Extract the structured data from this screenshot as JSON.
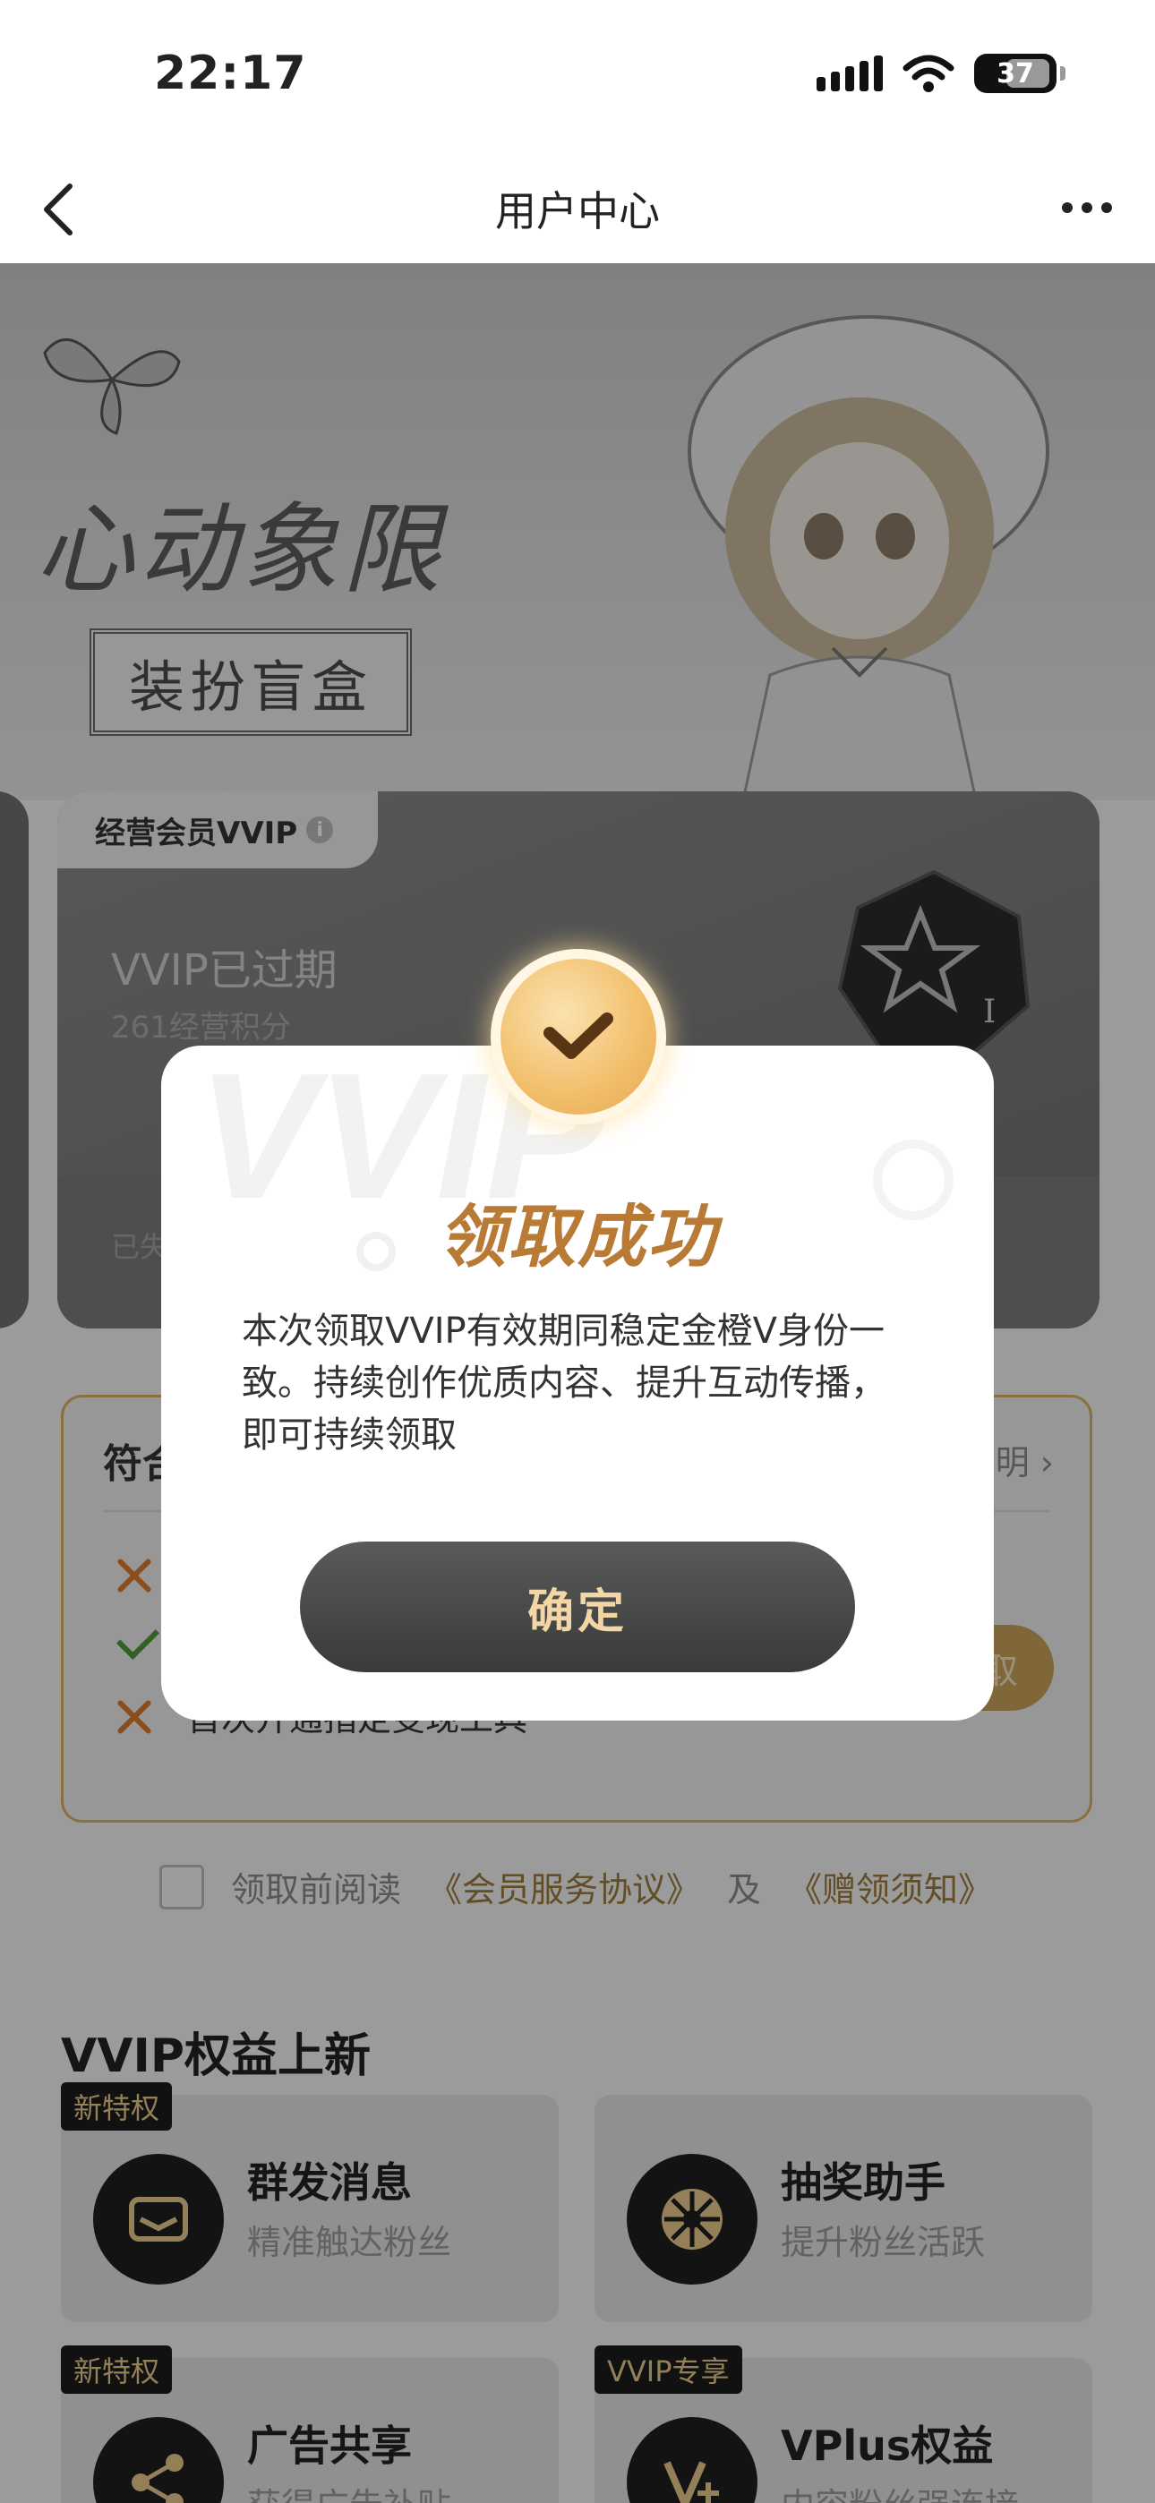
{
  "status_bar": {
    "time": "22:17",
    "battery": "37"
  },
  "nav": {
    "title": "用户中心"
  },
  "banner": {
    "title": "心动象限",
    "subtitle": "装扮盲盒"
  },
  "member_card": {
    "tag": "经营会员VVIP",
    "status": "VVIP已过期",
    "points": "261经营积分",
    "expired_note": "已失",
    "watermark": "VVIP"
  },
  "eligibility": {
    "title": "符合",
    "link": "明",
    "rows": [
      {
        "status": "fail",
        "text": ""
      },
      {
        "status": "pass",
        "text": ""
      },
      {
        "status": "fail",
        "text": "首次开通指定变现工具"
      }
    ],
    "claim_button": "取"
  },
  "agreement": {
    "prefix": "领取前阅读",
    "link1": "《会员服务协议》",
    "joiner": "及",
    "link2": "《赠领须知》"
  },
  "perks": {
    "section_title": "VVIP权益上新",
    "items": [
      {
        "badge": "新特权",
        "title": "群发消息",
        "desc": "精准触达粉丝",
        "icon": "mail-icon"
      },
      {
        "badge": "",
        "title": "抽奖助手",
        "desc": "提升粉丝活跃",
        "icon": "wheel-icon"
      },
      {
        "badge": "新特权",
        "title": "广告共享",
        "desc": "获得广告补贴",
        "icon": "share-icon"
      },
      {
        "badge": "VVIP专享",
        "title": "VPlus权益",
        "desc": "内容粉丝强连接",
        "icon": "vplus-icon"
      }
    ]
  },
  "dialog": {
    "title": "领取成功",
    "message": "本次领取VVIP有效期同稳定金橙V身份一致。持续创作优质内容、提升互动传播，即可持续领取",
    "confirm": "确定"
  },
  "colors": {
    "accent_gold": "#b87a35",
    "button_dark": "#3a3a3a",
    "button_text": "#f3d6a6",
    "fail_orange": "#d9792b",
    "pass_green": "#4c9a3a"
  }
}
